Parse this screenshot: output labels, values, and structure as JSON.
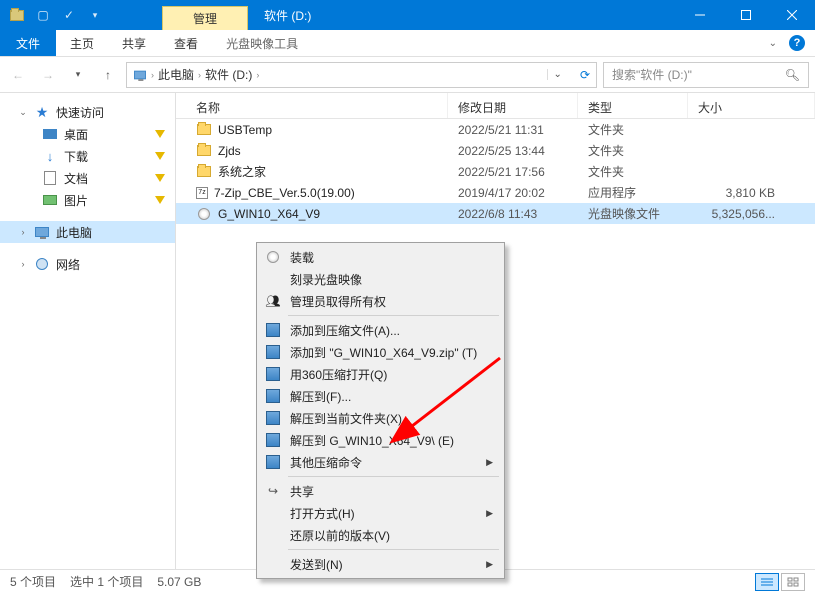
{
  "titlebar": {
    "context_tab": "管理",
    "title": "软件 (D:)"
  },
  "ribbon": {
    "file": "文件",
    "home": "主页",
    "share": "共享",
    "view": "查看",
    "ctx": "光盘映像工具"
  },
  "addr": {
    "seg1": "此电脑",
    "seg2": "软件 (D:)",
    "search_placeholder": "搜索\"软件 (D:)\""
  },
  "nav": {
    "quick": "快速访问",
    "desktop": "桌面",
    "downloads": "下载",
    "documents": "文档",
    "pictures": "图片",
    "thispc": "此电脑",
    "network": "网络"
  },
  "cols": {
    "name": "名称",
    "date": "修改日期",
    "type": "类型",
    "size": "大小"
  },
  "rows": [
    {
      "name": "USBTemp",
      "date": "2022/5/21 11:31",
      "type": "文件夹",
      "size": "",
      "icon": "folder"
    },
    {
      "name": "Zjds",
      "date": "2022/5/25 13:44",
      "type": "文件夹",
      "size": "",
      "icon": "folder"
    },
    {
      "name": "系统之家",
      "date": "2022/5/21 17:56",
      "type": "文件夹",
      "size": "",
      "icon": "folder"
    },
    {
      "name": "7-Zip_CBE_Ver.5.0(19.00)",
      "date": "2019/4/17 20:02",
      "type": "应用程序",
      "size": "3,810 KB",
      "icon": "zip"
    },
    {
      "name": "G_WIN10_X64_V9",
      "date": "2022/6/8 11:43",
      "type": "光盘映像文件",
      "size": "5,325,056...",
      "icon": "disc",
      "selected": true
    }
  ],
  "ctx": {
    "mount": "装载",
    "burn": "刻录光盘映像",
    "admin": "管理员取得所有权",
    "add_archive": "添加到压缩文件(A)...",
    "add_named": "添加到 \"G_WIN10_X64_V9.zip\" (T)",
    "open_360": "用360压缩打开(Q)",
    "extract_to": "解压到(F)...",
    "extract_here": "解压到当前文件夹(X)",
    "extract_named": "解压到 G_WIN10_X64_V9\\ (E)",
    "other_cmds": "其他压缩命令",
    "share": "共享",
    "open_with": "打开方式(H)",
    "restore": "还原以前的版本(V)",
    "send_to": "发送到(N)"
  },
  "status": {
    "items": "5 个项目",
    "selected": "选中 1 个项目",
    "size": "5.07 GB"
  }
}
